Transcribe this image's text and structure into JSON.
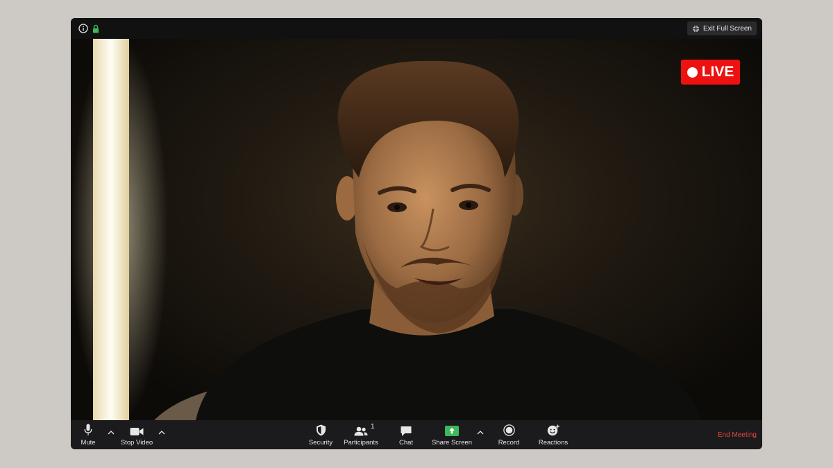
{
  "topbar": {
    "info_icon": "info-icon",
    "lock_icon": "lock-icon",
    "exit_fullscreen_label": "Exit Full Screen"
  },
  "video": {
    "live_badge": "LIVE",
    "colors": {
      "live": "#ee1111",
      "share_accent": "#3cb95a",
      "end": "#e8443a"
    }
  },
  "toolbar": {
    "mute_label": "Mute",
    "stop_video_label": "Stop Video",
    "security_label": "Security",
    "participants_label": "Participants",
    "participants_count": "1",
    "chat_label": "Chat",
    "share_screen_label": "Share Screen",
    "record_label": "Record",
    "reactions_label": "Reactions",
    "end_meeting_label": "End Meeting"
  }
}
